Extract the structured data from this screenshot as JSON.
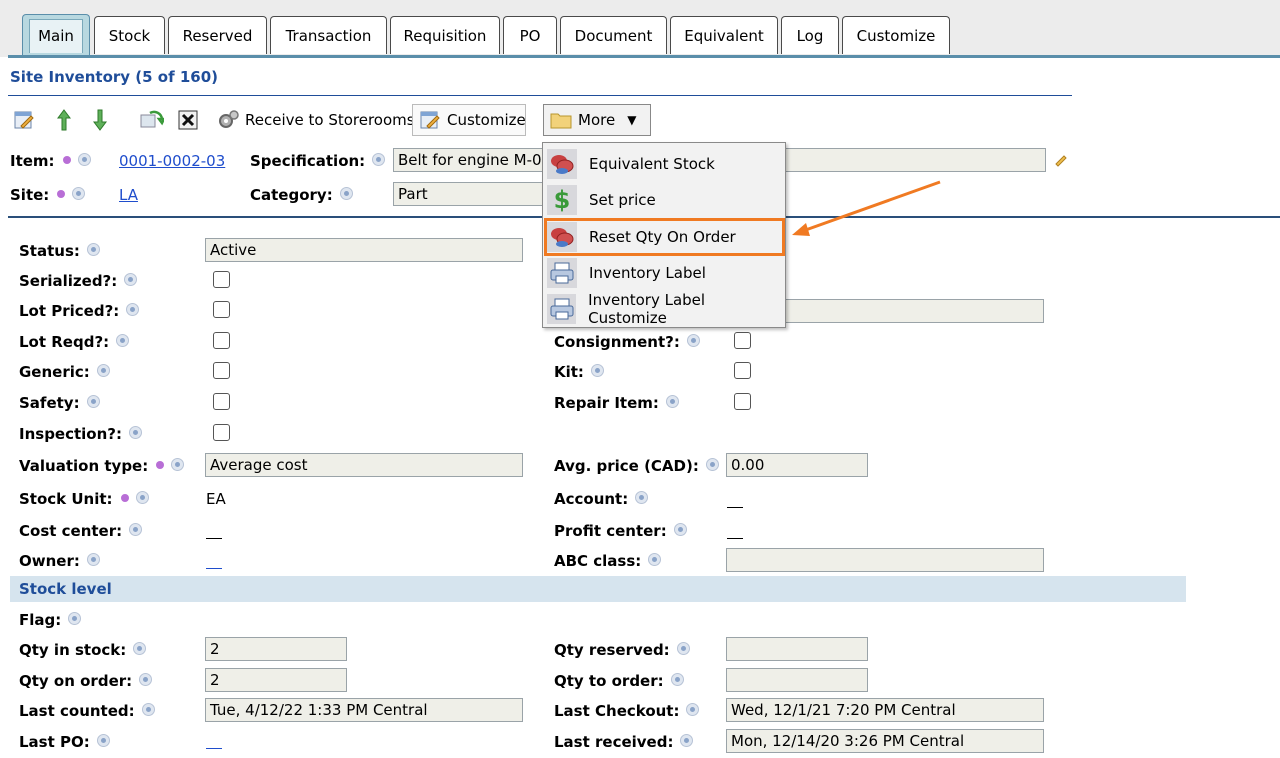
{
  "tabs": [
    "Main",
    "Stock",
    "Reserved",
    "Transaction",
    "Requisition",
    "PO",
    "Document",
    "Equivalent",
    "Log",
    "Customize"
  ],
  "section_title": "Site Inventory (5 of 160)",
  "toolbar": {
    "receive_label": "Receive to Storerooms",
    "customize_label": "Customize",
    "more_label": "More"
  },
  "header": {
    "item_label": "Item:",
    "item_value": "0001-0002-03",
    "site_label": "Site:",
    "site_value": "LA",
    "spec_label": "Specification:",
    "spec_value": "Belt for engine M-01",
    "category_label": "Category:",
    "category_value": "Part"
  },
  "menu": {
    "items": [
      "Equivalent Stock",
      "Set price",
      "Reset Qty On Order",
      "Inventory Label",
      "Inventory Label Customize"
    ]
  },
  "fields": {
    "status_label": "Status:",
    "status_value": "Active",
    "serialized_label": "Serialized?:",
    "lot_priced_label": "Lot Priced?:",
    "lot_reqd_label": "Lot Reqd?:",
    "generic_label": "Generic:",
    "safety_label": "Safety:",
    "inspection_label": "Inspection?:",
    "valuation_label": "Valuation type:",
    "valuation_value": "Average cost",
    "stock_unit_label": "Stock Unit:",
    "stock_unit_value": "EA",
    "cost_center_label": "Cost center:",
    "owner_label": "Owner:",
    "consignment_label": "Consignment?:",
    "kit_label": "Kit:",
    "repair_label": "Repair Item:",
    "avg_price_label": "Avg. price (CAD):",
    "avg_price_value": "0.00",
    "account_label": "Account:",
    "profit_center_label": "Profit center:",
    "abc_label": "ABC class:"
  },
  "stock": {
    "title": "Stock level",
    "flag_label": "Flag:",
    "qty_in_stock_label": "Qty in stock:",
    "qty_in_stock_value": "2",
    "qty_on_order_label": "Qty on order:",
    "qty_on_order_value": "2",
    "last_counted_label": "Last counted:",
    "last_counted_value": "Tue, 4/12/22 1:33 PM Central",
    "last_po_label": "Last PO:",
    "qty_reserved_label": "Qty reserved:",
    "qty_to_order_label": "Qty to order:",
    "last_checkout_label": "Last Checkout:",
    "last_checkout_value": "Wed, 12/1/21 7:20 PM Central",
    "last_received_label": "Last received:",
    "last_received_value": "Mon, 12/14/20 3:26 PM Central"
  },
  "colors": {
    "accent_blue": "#1f4d99",
    "highlight_orange": "#f07a22",
    "required_dot": "#b86ed6"
  }
}
